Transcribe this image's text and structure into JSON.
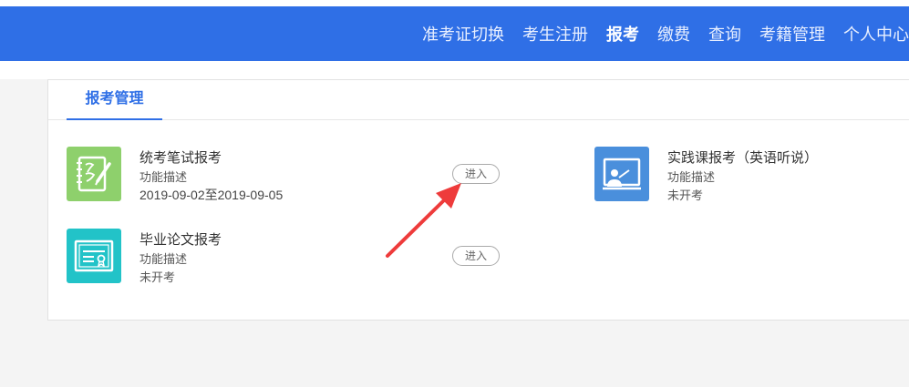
{
  "nav": {
    "items": [
      {
        "label": "准考证切换",
        "active": false
      },
      {
        "label": "考生注册",
        "active": false
      },
      {
        "label": "报考",
        "active": true
      },
      {
        "label": "缴费",
        "active": false
      },
      {
        "label": "查询",
        "active": false
      },
      {
        "label": "考籍管理",
        "active": false
      },
      {
        "label": "个人中心",
        "active": false
      }
    ]
  },
  "tabs": {
    "active_label": "报考管理"
  },
  "cards": [
    {
      "title": "统考笔试报考",
      "desc": "功能描述",
      "status": "2019-09-02至2019-09-05",
      "icon": "notebook-pen-icon",
      "icon_color": "#8ed06c",
      "button_label": "进入"
    },
    {
      "title": "毕业论文报考",
      "desc": "功能描述",
      "status": "未开考",
      "icon": "certificate-icon",
      "icon_color": "#22c3c8",
      "button_label": "进入"
    },
    {
      "title": "实践课报考（英语听说）",
      "desc": "功能描述",
      "status": "未开考",
      "icon": "presenter-board-icon",
      "icon_color": "#4a8fdc"
    }
  ],
  "colors": {
    "nav_bg": "#2f6fe6",
    "accent": "#2f6fe6",
    "arrow": "#ee3b3b"
  }
}
